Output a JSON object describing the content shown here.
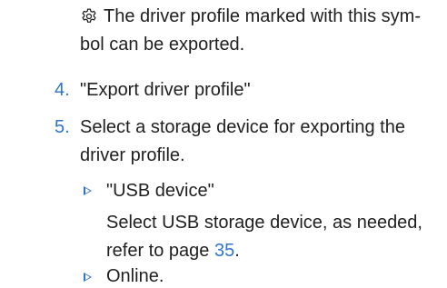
{
  "note": {
    "icon": "gear-icon",
    "line1": "The driver profile marked with this sym-",
    "line2": "bol can be exported."
  },
  "steps": [
    {
      "number": "4.",
      "line1": "\"Export driver profile\""
    },
    {
      "number": "5.",
      "line1": "Select a storage device for exporting the",
      "line2": "driver profile."
    }
  ],
  "options": [
    {
      "label": "\"USB device\"",
      "desc_line1": "Select USB storage device, as needed,",
      "desc_line2_prefix": "refer to page ",
      "page_link": "35",
      "desc_line2_suffix": "."
    },
    {
      "label": "Online."
    }
  ],
  "colors": {
    "accent": "#2f74c8",
    "text": "#1f1f1f"
  }
}
